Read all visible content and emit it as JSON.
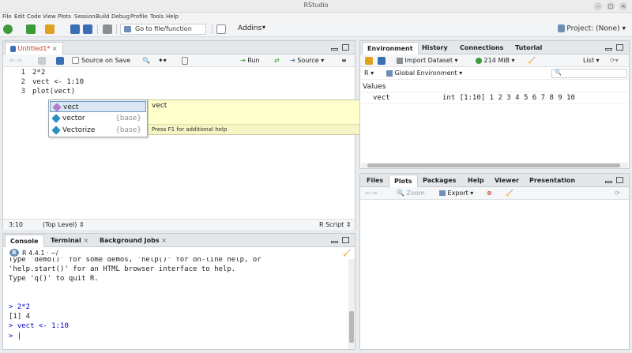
{
  "window": {
    "title": "RStudio",
    "min": "–",
    "max": "□",
    "close": "×"
  },
  "menu": [
    "File",
    "Edit",
    "Code",
    "View",
    "Plots",
    "Session",
    "Build",
    "Debug",
    "Profile",
    "Tools",
    "Help"
  ],
  "toolbar": {
    "goto_placeholder": "Go to file/function",
    "addins_label": "Addins",
    "project_label": "Project: (None)"
  },
  "editor": {
    "tab_label": "Untitled1*",
    "source_on_save": "Source on Save",
    "run_label": "Run",
    "source_label": "Source",
    "lines": [
      {
        "n": "1",
        "text": "2*2"
      },
      {
        "n": "2",
        "text": "vect <- 1:10"
      },
      {
        "n": "3",
        "text": "plot(vect)"
      }
    ],
    "status": {
      "position": "3:10",
      "scope": "(Top Level)",
      "filetype": "R Script"
    }
  },
  "autocomplete": {
    "items": [
      {
        "name": "vect",
        "pkg": "",
        "color": "#b07fd0"
      },
      {
        "name": "vector",
        "pkg": "{base}",
        "color": "#2a8fc0"
      },
      {
        "name": "Vectorize",
        "pkg": "{base}",
        "color": "#2a8fc0"
      }
    ],
    "help_title": "vect",
    "help_footer": "Press F1 for additional help"
  },
  "console": {
    "tabs": [
      "Console",
      "Terminal",
      "Background Jobs"
    ],
    "version": "R 4.4.1 · ~/",
    "lines": [
      {
        "text": "Type 'demo()' for some demos, 'help()' for on-line help, or",
        "cls": ""
      },
      {
        "text": "'help.start()' for an HTML browser interface to help.",
        "cls": ""
      },
      {
        "text": "Type 'q()' to quit R.",
        "cls": ""
      },
      {
        "text": "",
        "cls": ""
      },
      {
        "text": "",
        "cls": ""
      },
      {
        "text": "> 2*2",
        "cls": "blue"
      },
      {
        "text": "[1] 4",
        "cls": ""
      },
      {
        "text": "> vect <- 1:10",
        "cls": "blue"
      },
      {
        "text": "> |",
        "cls": "blue"
      }
    ]
  },
  "environment": {
    "tabs": [
      "Environment",
      "History",
      "Connections",
      "Tutorial"
    ],
    "import_label": "Import Dataset",
    "memory_label": "214 MiB",
    "list_label": "List",
    "lang_label": "R",
    "scope_label": "Global Environment",
    "section_label": "Values",
    "rows": [
      {
        "name": "vect",
        "value": "int [1:10] 1 2 3 4 5 6 7 8 9 10"
      }
    ]
  },
  "files": {
    "tabs": [
      "Files",
      "Plots",
      "Packages",
      "Help",
      "Viewer",
      "Presentation"
    ],
    "zoom_label": "Zoom",
    "export_label": "Export"
  }
}
